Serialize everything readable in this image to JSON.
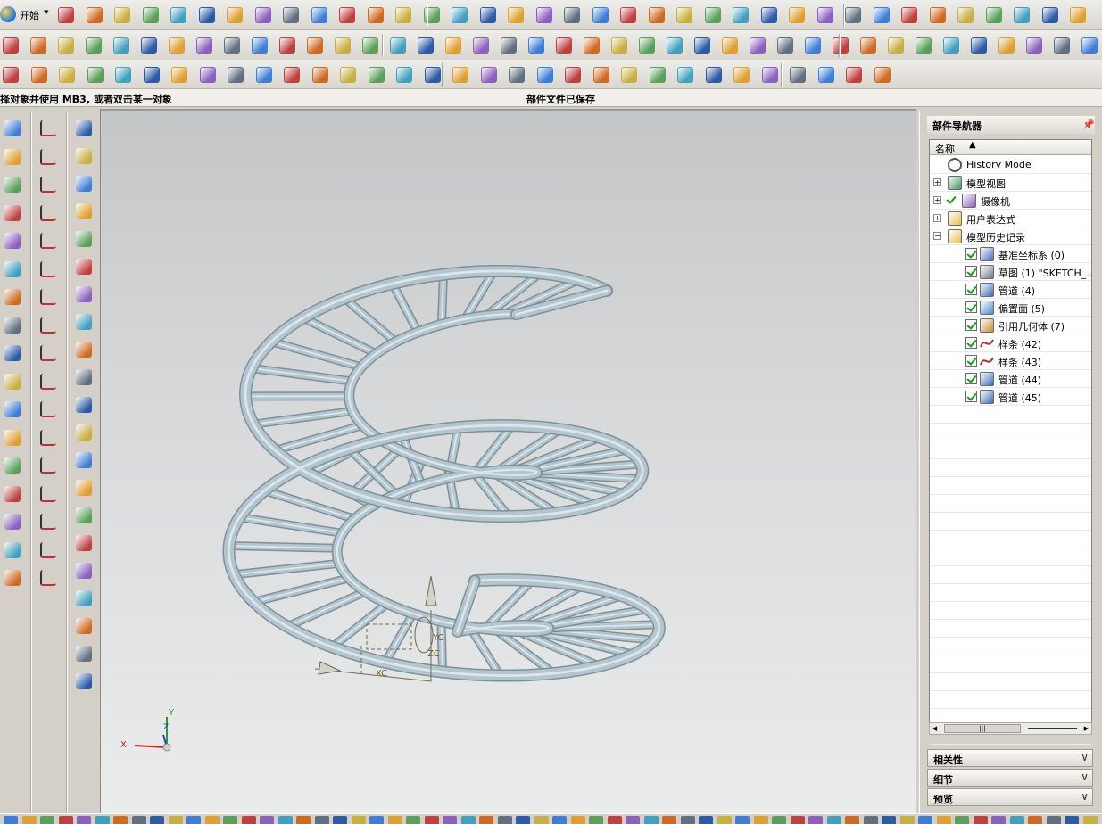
{
  "menu": {
    "start_label": "开始"
  },
  "status": {
    "prompt": "择对象并使用 MB3, 或者双击某一对象",
    "message": "部件文件已保存"
  },
  "navigator": {
    "title": "部件导航器",
    "column_name": "名称",
    "items": [
      {
        "label": "History Mode",
        "icon": "clock-icon"
      },
      {
        "label": "模型视图",
        "icon": "model-view-icon"
      },
      {
        "label": "摄像机",
        "icon": "camera-icon"
      },
      {
        "label": "用户表达式",
        "icon": "folder-icon"
      },
      {
        "label": "模型历史记录",
        "icon": "folder-open-icon"
      },
      {
        "label": "基准坐标系 (0)",
        "icon": "datum-csys-icon"
      },
      {
        "label": "草图 (1) \"SKETCH_...",
        "icon": "sketch-icon"
      },
      {
        "label": "管道 (4)",
        "icon": "tube-icon"
      },
      {
        "label": "偏置面 (5)",
        "icon": "offset-face-icon"
      },
      {
        "label": "引用几何体 (7)",
        "icon": "extract-geometry-icon"
      },
      {
        "label": "样条 (42)",
        "icon": "spline-icon"
      },
      {
        "label": "样条 (43)",
        "icon": "spline-icon"
      },
      {
        "label": "管道 (44)",
        "icon": "tube-icon"
      },
      {
        "label": "管道 (45)",
        "icon": "tube-icon"
      }
    ],
    "panels": [
      "相关性",
      "细节",
      "预览"
    ]
  },
  "viewport": {
    "wcs_labels": {
      "xc": "XC",
      "yc": "YC",
      "zc": "ZC"
    },
    "triad_labels": {
      "x": "X",
      "y": "Y",
      "z": "Z"
    }
  },
  "colors": {
    "tube": "#b3c6cf",
    "tube_edge": "#7f9197",
    "viewport_top": "#c4c6c7",
    "viewport_bottom": "#ebecec",
    "check": "#149c14"
  }
}
